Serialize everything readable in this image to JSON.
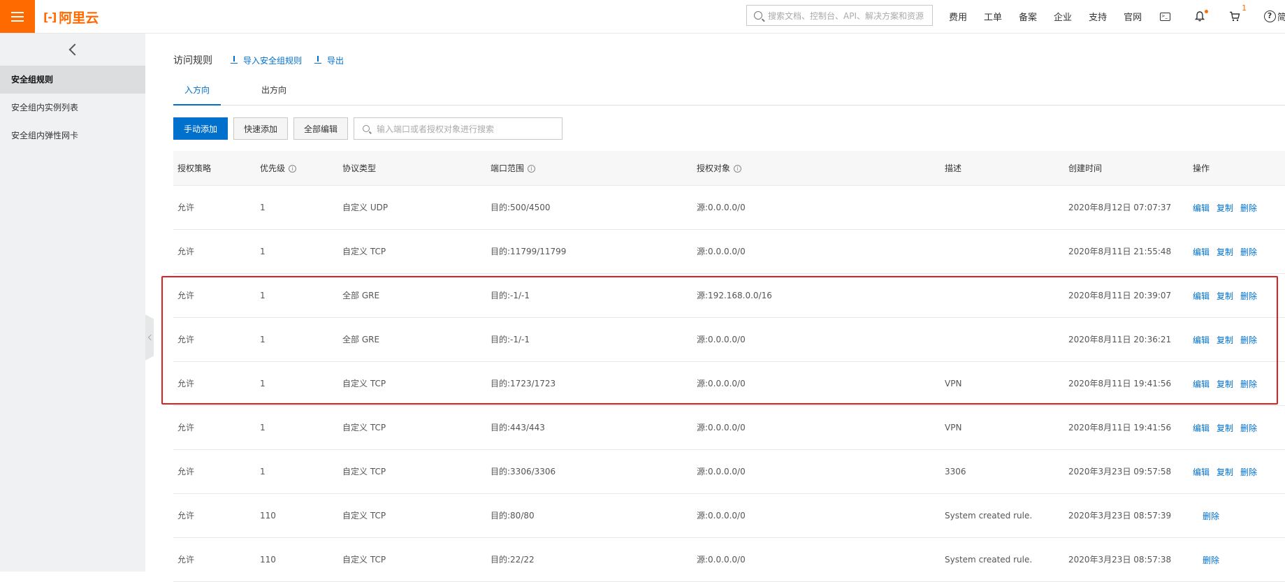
{
  "header": {
    "logo_text": "阿里云",
    "search_placeholder": "搜索文档、控制台、API、解决方案和资源",
    "nav": [
      "费用",
      "工单",
      "备案",
      "企业",
      "支持",
      "官网"
    ],
    "cart_count": "1",
    "lang": "简",
    "brand_color": "#ff6a00"
  },
  "sidebar": {
    "items": [
      "安全组规则",
      "安全组内实例列表",
      "安全组内弹性网卡"
    ],
    "active_index": 0
  },
  "main": {
    "title": "访问规则",
    "import_label": "导入安全组规则",
    "export_label": "导出",
    "tabs": [
      "入方向",
      "出方向"
    ],
    "active_tab": 0,
    "buttons": {
      "manual_add": "手动添加",
      "quick_add": "快速添加",
      "edit_all": "全部编辑"
    },
    "table_search_placeholder": "输入端口或者授权对象进行搜索",
    "accent_color": "#0070cc"
  },
  "table": {
    "columns": [
      "授权策略",
      "优先级",
      "协议类型",
      "端口范围",
      "授权对象",
      "描述",
      "创建时间",
      "操作"
    ],
    "rows": [
      {
        "policy": "允许",
        "priority": "1",
        "protocol": "自定义 UDP",
        "port": "目的:500/4500",
        "source": "源:0.0.0.0/0",
        "desc": "",
        "created": "2020年8月12日 07:07:37",
        "ops": [
          "编辑",
          "复制",
          "删除"
        ]
      },
      {
        "policy": "允许",
        "priority": "1",
        "protocol": "自定义 TCP",
        "port": "目的:11799/11799",
        "source": "源:0.0.0.0/0",
        "desc": "",
        "created": "2020年8月11日 21:55:48",
        "ops": [
          "编辑",
          "复制",
          "删除"
        ]
      },
      {
        "policy": "允许",
        "priority": "1",
        "protocol": "全部 GRE",
        "port": "目的:-1/-1",
        "source": "源:192.168.0.0/16",
        "desc": "",
        "created": "2020年8月11日 20:39:07",
        "ops": [
          "编辑",
          "复制",
          "删除"
        ]
      },
      {
        "policy": "允许",
        "priority": "1",
        "protocol": "全部 GRE",
        "port": "目的:-1/-1",
        "source": "源:0.0.0.0/0",
        "desc": "",
        "created": "2020年8月11日 20:36:21",
        "ops": [
          "编辑",
          "复制",
          "删除"
        ]
      },
      {
        "policy": "允许",
        "priority": "1",
        "protocol": "自定义 TCP",
        "port": "目的:1723/1723",
        "source": "源:0.0.0.0/0",
        "desc": "VPN",
        "created": "2020年8月11日 19:41:56",
        "ops": [
          "编辑",
          "复制",
          "删除"
        ]
      },
      {
        "policy": "允许",
        "priority": "1",
        "protocol": "自定义 TCP",
        "port": "目的:443/443",
        "source": "源:0.0.0.0/0",
        "desc": "VPN",
        "created": "2020年8月11日 19:41:56",
        "ops": [
          "编辑",
          "复制",
          "删除"
        ]
      },
      {
        "policy": "允许",
        "priority": "1",
        "protocol": "自定义 TCP",
        "port": "目的:3306/3306",
        "source": "源:0.0.0.0/0",
        "desc": "3306",
        "created": "2020年3月23日 09:57:58",
        "ops": [
          "编辑",
          "复制",
          "删除"
        ]
      },
      {
        "policy": "允许",
        "priority": "110",
        "protocol": "自定义 TCP",
        "port": "目的:80/80",
        "source": "源:0.0.0.0/0",
        "desc": "System created rule.",
        "created": "2020年3月23日 08:57:39",
        "ops": [
          "删除"
        ]
      },
      {
        "policy": "允许",
        "priority": "110",
        "protocol": "自定义 TCP",
        "port": "目的:22/22",
        "source": "源:0.0.0.0/0",
        "desc": "System created rule.",
        "created": "2020年3月23日 08:57:38",
        "ops": [
          "删除"
        ]
      }
    ]
  }
}
